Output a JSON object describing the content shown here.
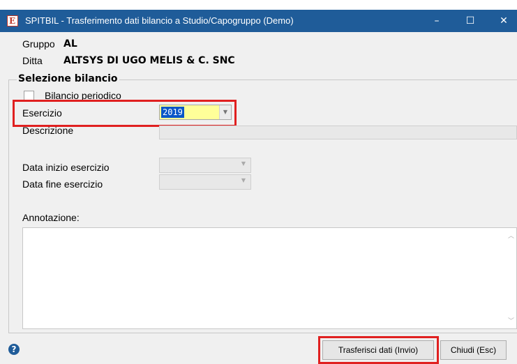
{
  "window": {
    "title": "SPITBIL - Trasferimento dati bilancio a Studio/Capogruppo  (Demo)",
    "app_icon_glyph": "E",
    "minimize_glyph": "–",
    "maximize_glyph": "☐",
    "close_glyph": "✕"
  },
  "header": {
    "gruppo_label": "Gruppo",
    "gruppo_value": "AL",
    "ditta_label": "Ditta",
    "ditta_value": "ALTSYS DI UGO MELIS & C. SNC"
  },
  "selezione": {
    "group_title": "Selezione bilancio",
    "bilancio_periodico_label": "Bilancio periodico",
    "bilancio_periodico_checked": false,
    "esercizio_label": "Esercizio",
    "esercizio_value": "2019",
    "descrizione_label": "Descrizione",
    "descrizione_value": "",
    "data_inizio_label": "Data inizio esercizio",
    "data_fine_label": "Data fine esercizio",
    "annotazione_label": "Annotazione:",
    "annotazione_value": ""
  },
  "footer": {
    "help_glyph": "?",
    "transfer_button": "Trasferisci dati (Invio)",
    "close_button": "Chiudi (Esc)"
  },
  "colors": {
    "titlebar": "#1f5c99",
    "highlight_box": "#e02020",
    "combo_background": "#ffff99",
    "selection": "#0a56c8"
  }
}
